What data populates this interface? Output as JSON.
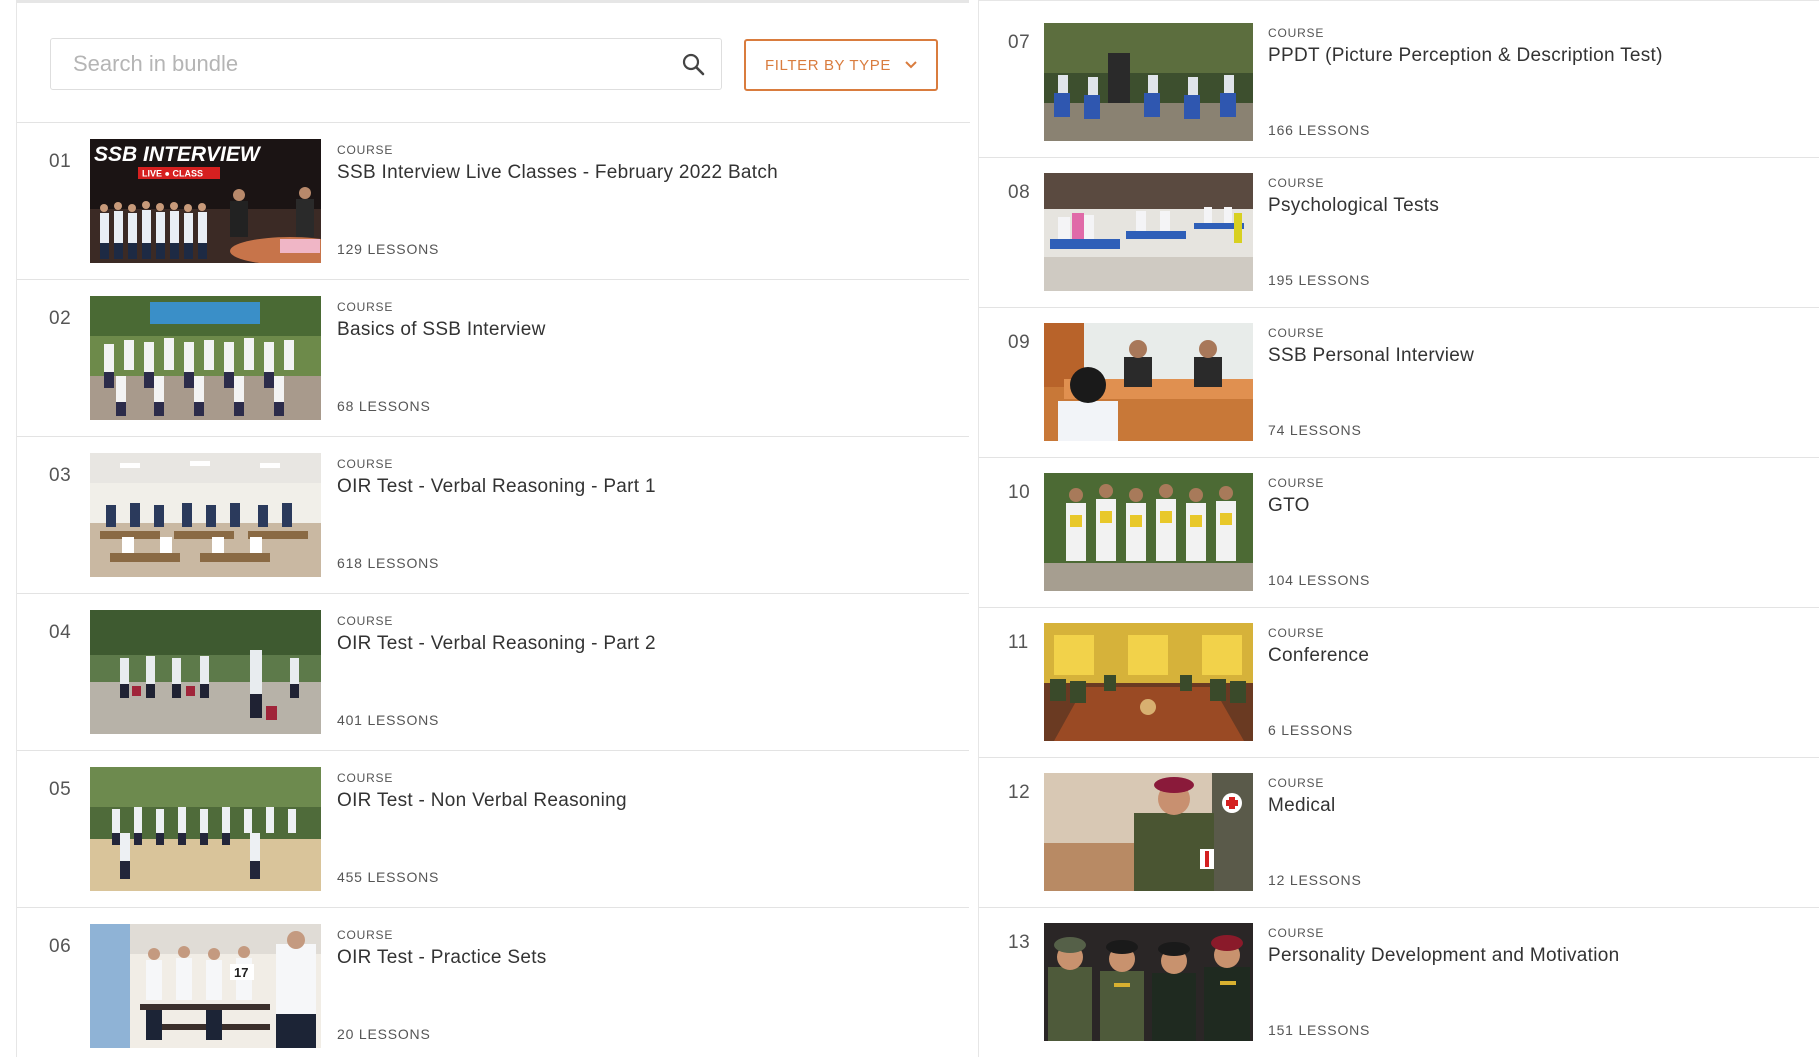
{
  "search": {
    "placeholder": "Search in bundle"
  },
  "filter": {
    "label": "FILTER BY TYPE"
  },
  "colors": {
    "accent": "#d97c3e",
    "border": "#e3e3e3",
    "text": "#333333",
    "muted": "#555555"
  },
  "courses": [
    {
      "number": "01",
      "type": "COURSE",
      "title": "SSB Interview Live Classes - February 2022 Batch",
      "lessons": "129 LESSONS",
      "thumb_text": "SSB INTERVIEW",
      "thumb_badge": "LIVE ● CLASS"
    },
    {
      "number": "02",
      "type": "COURSE",
      "title": "Basics of SSB Interview",
      "lessons": "68 LESSONS"
    },
    {
      "number": "03",
      "type": "COURSE",
      "title": "OIR Test - Verbal Reasoning - Part 1",
      "lessons": "618 LESSONS"
    },
    {
      "number": "04",
      "type": "COURSE",
      "title": "OIR Test - Verbal Reasoning - Part 2",
      "lessons": "401 LESSONS"
    },
    {
      "number": "05",
      "type": "COURSE",
      "title": "OIR Test - Non Verbal Reasoning",
      "lessons": "455 LESSONS"
    },
    {
      "number": "06",
      "type": "COURSE",
      "title": "OIR Test - Practice Sets",
      "lessons": "20 LESSONS"
    },
    {
      "number": "07",
      "type": "COURSE",
      "title": "PPDT (Picture Perception & Description Test)",
      "lessons": "166 LESSONS"
    },
    {
      "number": "08",
      "type": "COURSE",
      "title": "Psychological Tests",
      "lessons": "195 LESSONS"
    },
    {
      "number": "09",
      "type": "COURSE",
      "title": "SSB Personal Interview",
      "lessons": "74 LESSONS"
    },
    {
      "number": "10",
      "type": "COURSE",
      "title": "GTO",
      "lessons": "104 LESSONS"
    },
    {
      "number": "11",
      "type": "COURSE",
      "title": "Conference",
      "lessons": "6 LESSONS"
    },
    {
      "number": "12",
      "type": "COURSE",
      "title": "Medical",
      "lessons": "12 LESSONS"
    },
    {
      "number": "13",
      "type": "COURSE",
      "title": "Personality Development and Motivation",
      "lessons": "151 LESSONS"
    }
  ]
}
